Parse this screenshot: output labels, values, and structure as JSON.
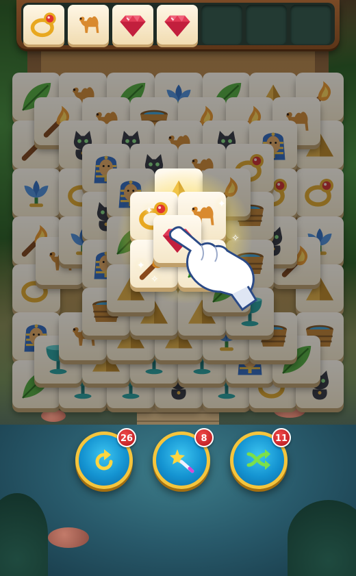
{
  "tray": {
    "slots": [
      "ruby-ring",
      "camel",
      "ruby-gem",
      "ruby-gem",
      "empty",
      "empty",
      "empty"
    ]
  },
  "board": {
    "highlighted_tile": "ruby-gem",
    "tile_types": [
      "leaf",
      "camel",
      "torch",
      "lotus",
      "pyramid",
      "ring",
      "bowl",
      "cat",
      "pharaoh",
      "gem",
      "goblet"
    ]
  },
  "boosters": [
    {
      "name": "undo",
      "count": "26"
    },
    {
      "name": "magic-wand-hint",
      "count": "8"
    },
    {
      "name": "shuffle",
      "count": "11"
    }
  ],
  "colors": {
    "tile_face": "#fbf2de",
    "tile_edge": "#bf9f6a",
    "booster_blue": "#1493d1",
    "booster_rim": "#f5c53c",
    "badge_red": "#d3262b"
  }
}
